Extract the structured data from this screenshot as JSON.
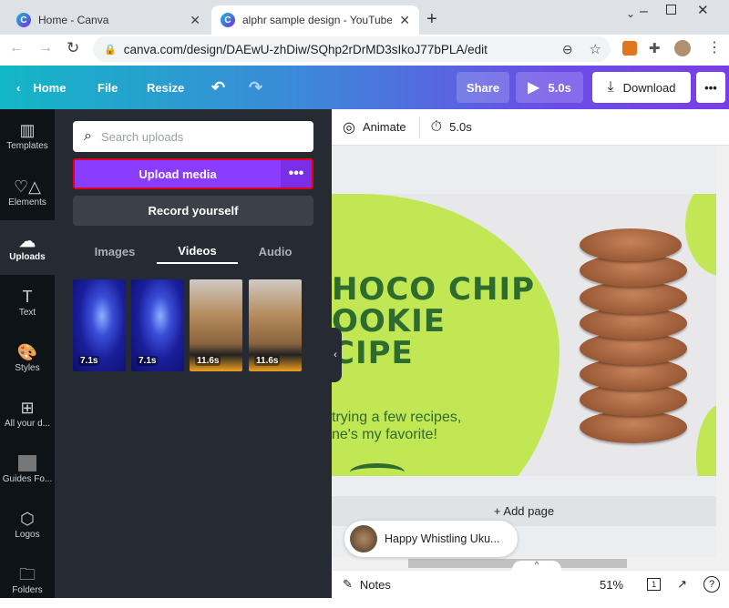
{
  "browser": {
    "tabs": [
      {
        "title": "Home - Canva",
        "active": false
      },
      {
        "title": "alphr sample design - YouTube Thumbnail",
        "active": true
      }
    ],
    "url": "canva.com/design/DAEwU-zhDiw/SQhp2rDrMD3sIkoJ77bPLA/edit"
  },
  "header": {
    "home": "Home",
    "file": "File",
    "resize": "Resize",
    "share": "Share",
    "play_duration": "5.0s",
    "download": "Download",
    "more": "•••"
  },
  "rail": [
    {
      "label": "Templates",
      "icon": "▥"
    },
    {
      "label": "Elements",
      "icon": "♡△"
    },
    {
      "label": "Uploads",
      "icon": "☁"
    },
    {
      "label": "Text",
      "icon": "T"
    },
    {
      "label": "Styles",
      "icon": "🎨"
    },
    {
      "label": "All your d...",
      "icon": "⊞"
    },
    {
      "label": "Guides Fo...",
      "icon": ""
    },
    {
      "label": "Logos",
      "icon": "⬡"
    },
    {
      "label": "Folders",
      "icon": "🗀"
    }
  ],
  "panel": {
    "search_placeholder": "Search uploads",
    "upload_label": "Upload media",
    "upload_more": "•••",
    "record_label": "Record yourself",
    "tabs": [
      "Images",
      "Videos",
      "Audio"
    ],
    "active_tab": "Videos",
    "videos": [
      {
        "duration": "7.1s"
      },
      {
        "duration": "7.1s"
      },
      {
        "duration": "11.6s"
      },
      {
        "duration": "11.6s"
      }
    ]
  },
  "canvas": {
    "animate": "Animate",
    "duration": "5.0s",
    "headline": [
      "HOCO CHIP",
      "OOKIE",
      "CIPE"
    ],
    "subtext": [
      "trying a few recipes,",
      "ne's my favorite!"
    ],
    "add_page": "+ Add page",
    "music_title": "Happy Whistling Uku..."
  },
  "footer": {
    "notes": "Notes",
    "zoom": "51%",
    "page": "1"
  },
  "colors": {
    "accent": "#8b3dff",
    "highlight": "#e3001b",
    "design_green": "#c1e854",
    "text_green": "#2e6b2e"
  }
}
